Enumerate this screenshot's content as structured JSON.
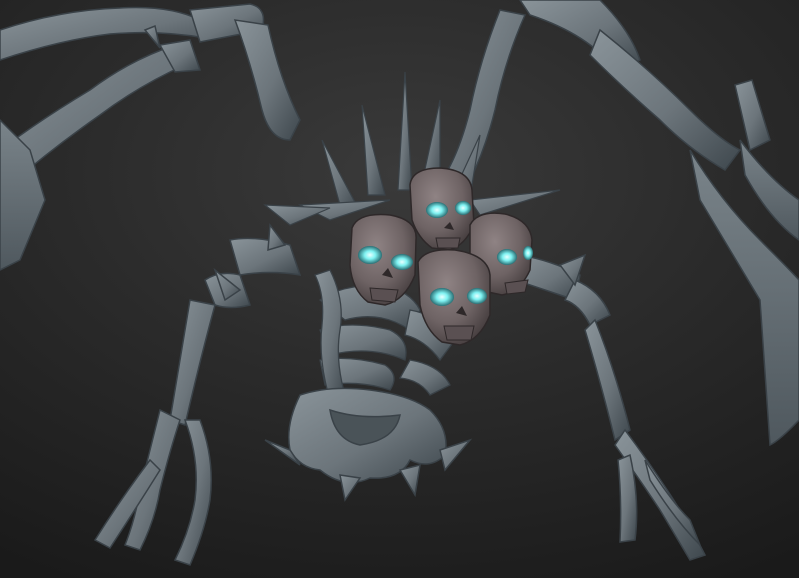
{
  "scene": {
    "subject": "skeletal-multi-skull-creature-sculpt",
    "colors": {
      "background_top": "#3a3a3a",
      "background_bottom": "#1a1a1a",
      "bone": "#6c757b",
      "bone_light": "#8a949a",
      "bone_dark": "#3e474d",
      "skull": "#7a6f70",
      "eye_glow": "#7ff2f2"
    },
    "skull_count": 4
  }
}
